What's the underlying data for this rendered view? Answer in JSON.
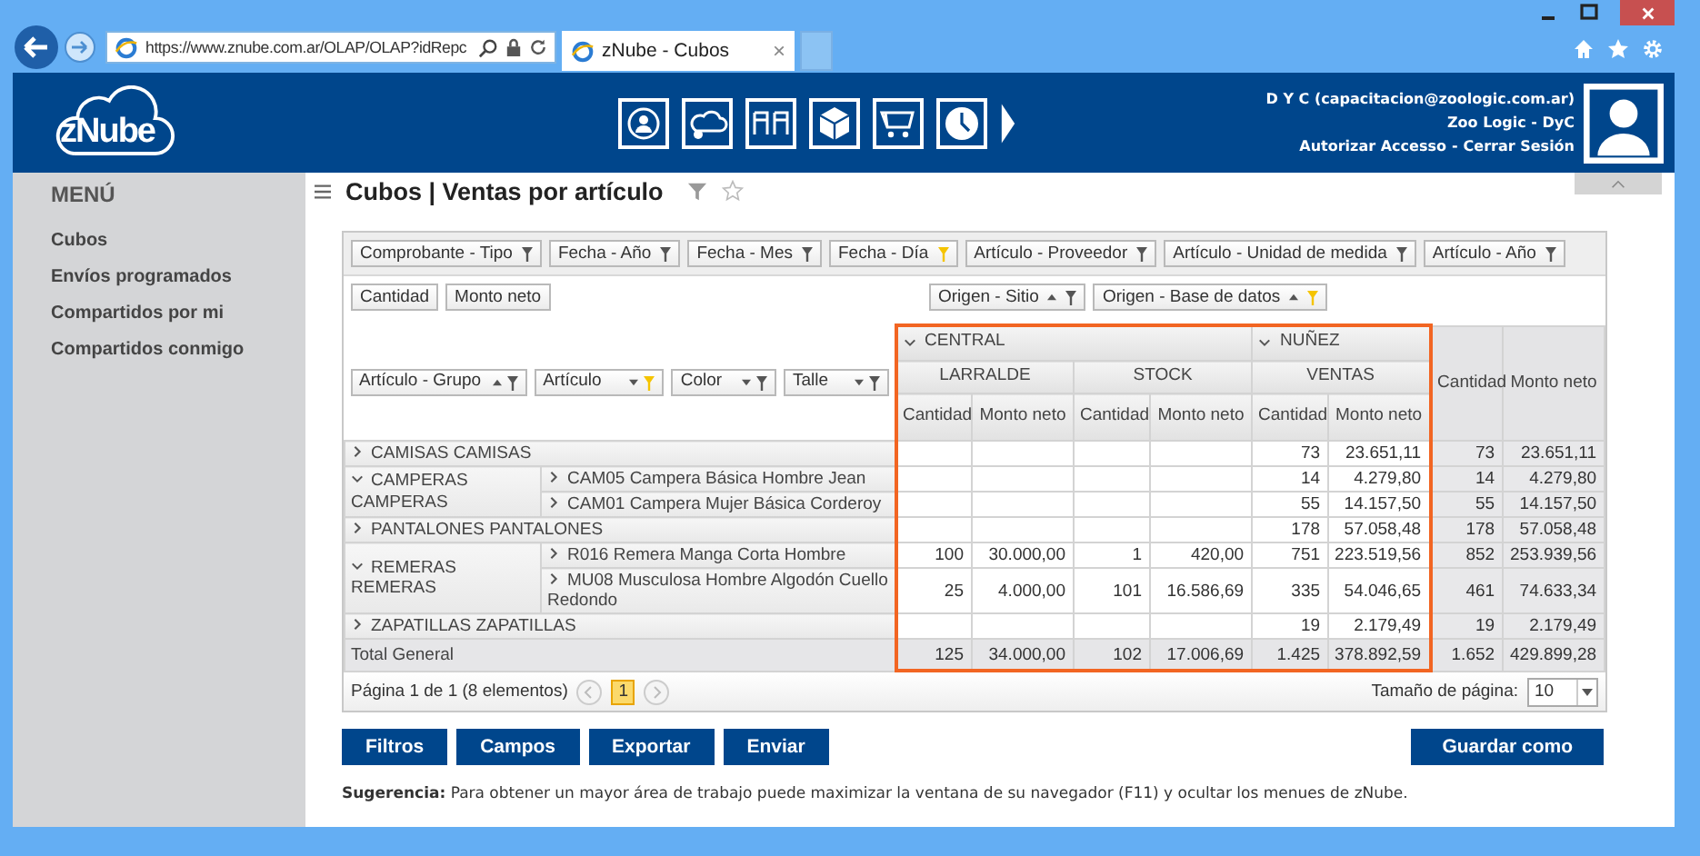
{
  "browser": {
    "url": "https://www.znube.com.ar/OLAP/OLAP?idRepc",
    "tab": {
      "title": "zNube - Cubos",
      "close": "×"
    }
  },
  "header": {
    "logo": "zNube",
    "user": "D Y C (capacitacion@zoologic.com.ar)",
    "company": "Zoo Logic - DyC",
    "links": [
      "Autorizar Accesso",
      "Cerrar Sesión"
    ],
    "link_separator": "-"
  },
  "sidebar": {
    "title": "MENÚ",
    "items": [
      "Cubos",
      "Envíos programados",
      "Compartidos por mi",
      "Compartidos conmigo"
    ]
  },
  "page": {
    "title": "Cubos | Ventas por artículo"
  },
  "pivot": {
    "filter_fields": [
      {
        "label": "Comprobante - Tipo",
        "filtered": false
      },
      {
        "label": "Fecha - Año",
        "filtered": false
      },
      {
        "label": "Fecha - Mes",
        "filtered": false
      },
      {
        "label": "Fecha - Día",
        "filtered": true
      },
      {
        "label": "Artículo - Proveedor",
        "filtered": false
      },
      {
        "label": "Artículo - Unidad de medida",
        "filtered": false
      },
      {
        "label": "Artículo - Año",
        "filtered": false
      }
    ],
    "data_fields": [
      "Cantidad",
      "Monto neto"
    ],
    "column_fields": [
      {
        "label": "Origen - Sitio",
        "ascending": true,
        "filtered": false
      },
      {
        "label": "Origen - Base de datos",
        "ascending": true,
        "filtered": true
      }
    ],
    "row_fields": [
      {
        "label": "Artículo - Grupo",
        "ascending": true,
        "filtered": false
      },
      {
        "label": "Artículo",
        "ascending": false,
        "filtered": true
      },
      {
        "label": "Color",
        "ascending": false,
        "filtered": false
      },
      {
        "label": "Talle",
        "ascending": false,
        "filtered": false
      }
    ],
    "highlight": true,
    "column_groups": [
      {
        "label": "CENTRAL",
        "expanded": true,
        "children": [
          {
            "label": "LARRALDE",
            "measures": [
              "Cantidad",
              "Monto neto"
            ]
          },
          {
            "label": "STOCK",
            "measures": [
              "Cantidad",
              "Monto neto"
            ]
          }
        ]
      },
      {
        "label": "NUÑEZ",
        "expanded": true,
        "children": [
          {
            "label": "VENTAS",
            "measures": [
              "Cantidad",
              "Monto neto"
            ]
          }
        ]
      }
    ],
    "grand_total_measures": [
      "Cantidad",
      "Monto neto"
    ],
    "rows": [
      {
        "label": "CAMISAS CAMISAS",
        "expanded": false,
        "values": {
          "ventas_cantidad": "73",
          "ventas_monto_neto": "23.651,11",
          "total_cantidad": "73",
          "total_monto_neto": "23.651,11"
        }
      },
      {
        "label": "CAMPERAS CAMPERAS",
        "expanded": true,
        "children": [
          {
            "label": "CAM05 Campera Básica Hombre Jean",
            "expanded": false,
            "values": {
              "ventas_cantidad": "14",
              "ventas_monto_neto": "4.279,80",
              "total_cantidad": "14",
              "total_monto_neto": "4.279,80"
            }
          },
          {
            "label": "CAM01 Campera Mujer Básica Corderoy",
            "expanded": false,
            "values": {
              "ventas_cantidad": "55",
              "ventas_monto_neto": "14.157,50",
              "total_cantidad": "55",
              "total_monto_neto": "14.157,50"
            }
          }
        ]
      },
      {
        "label": "PANTALONES PANTALONES",
        "expanded": false,
        "values": {
          "ventas_cantidad": "178",
          "ventas_monto_neto": "57.058,48",
          "total_cantidad": "178",
          "total_monto_neto": "57.058,48"
        }
      },
      {
        "label": "REMERAS REMERAS",
        "expanded": true,
        "children": [
          {
            "label": "R016 Remera Manga Corta Hombre",
            "expanded": false,
            "values": {
              "larralde_cantidad": "100",
              "larralde_monto_neto": "30.000,00",
              "stock_cantidad": "1",
              "stock_monto_neto": "420,00",
              "ventas_cantidad": "751",
              "ventas_monto_neto": "223.519,56",
              "total_cantidad": "852",
              "total_monto_neto": "253.939,56"
            }
          },
          {
            "label": "MU08 Musculosa Hombre Algodón Cuello Redondo",
            "expanded": false,
            "values": {
              "larralde_cantidad": "25",
              "larralde_monto_neto": "4.000,00",
              "stock_cantidad": "101",
              "stock_monto_neto": "16.586,69",
              "ventas_cantidad": "335",
              "ventas_monto_neto": "54.046,65",
              "total_cantidad": "461",
              "total_monto_neto": "74.633,34"
            }
          }
        ]
      },
      {
        "label": "ZAPATILLAS ZAPATILLAS",
        "expanded": false,
        "values": {
          "ventas_cantidad": "19",
          "ventas_monto_neto": "2.179,49",
          "total_cantidad": "19",
          "total_monto_neto": "2.179,49"
        }
      }
    ],
    "total": {
      "label": "Total General",
      "values": {
        "larralde_cantidad": "125",
        "larralde_monto_neto": "34.000,00",
        "stock_cantidad": "102",
        "stock_monto_neto": "17.006,69",
        "ventas_cantidad": "1.425",
        "ventas_monto_neto": "378.892,59",
        "total_cantidad": "1.652",
        "total_monto_neto": "429.899,28"
      }
    },
    "pager": {
      "summary": "Página 1 de 1 (8 elementos)",
      "pages": [
        {
          "label": "1",
          "selected": true
        }
      ],
      "size_label": "Tamaño de página:",
      "size": "10"
    }
  },
  "buttons": [
    "Filtros",
    "Campos",
    "Exportar",
    "Enviar"
  ],
  "save_button": "Guardar como",
  "hint": "**Sugerencia:** Para obtener un mayor área de trabajo puede maximizar la ventana de su navegador (F11) y ocultar los menues de zNube."
}
